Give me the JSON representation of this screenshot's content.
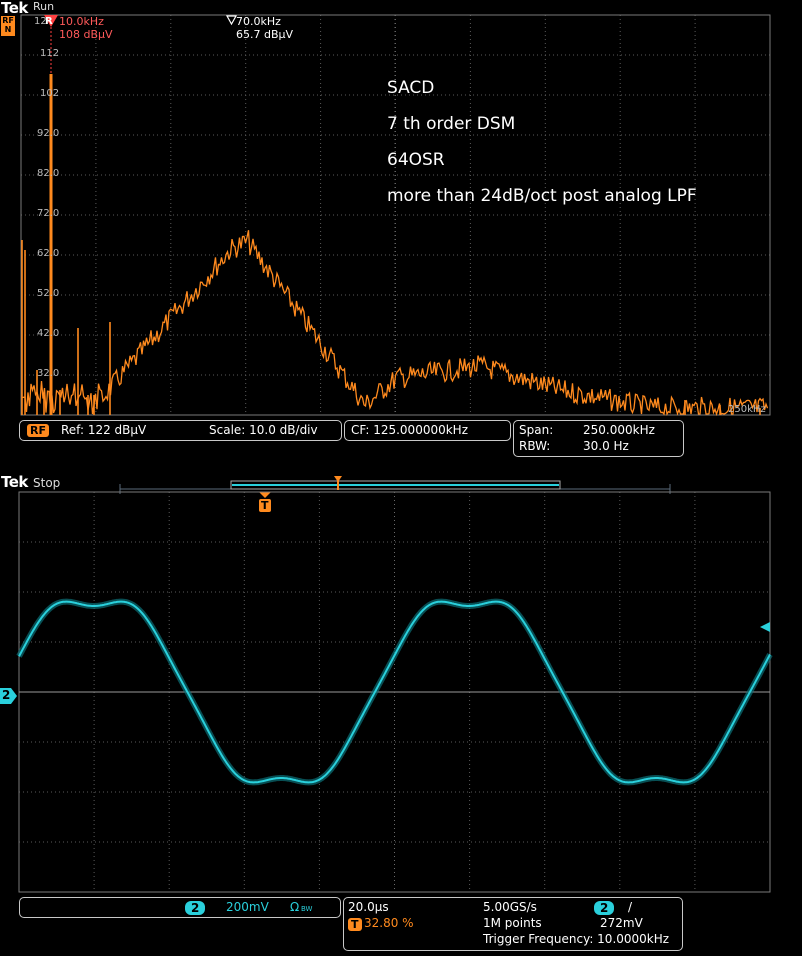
{
  "top": {
    "brand": "Tek",
    "run_state": "Run",
    "rf_icon_letters": "RF",
    "rf_icon_n": "N",
    "marker_ref": {
      "badge": "R",
      "freq": "10.0kHz",
      "level": "108 dBµV"
    },
    "marker_delta": {
      "freq": "70.0kHz",
      "level": "65.7 dBµV"
    },
    "y_labels": [
      "112",
      "102",
      "92.0",
      "82.0",
      "72.0",
      "62.0",
      "52.0",
      "42.0",
      "32.0"
    ],
    "y_top_partial": "12",
    "x_end_label": "250kHz",
    "annotation": [
      "SACD",
      "7 th order DSM",
      "64OSR",
      "more than 24dB/oct post analog LPF"
    ],
    "status": {
      "rf_badge": "RF",
      "ref": "Ref: 122 dBµV",
      "scale": "Scale: 10.0 dB/div",
      "cf": "CF:   125.000000kHz",
      "span_label": "Span:",
      "span_value": "250.000kHz",
      "rbw_label": "RBW:",
      "rbw_value": "30.0 Hz"
    },
    "colors": {
      "trace": "#ff8a1e",
      "grid": "#5a5a5a",
      "frame": "#7a7a7a"
    }
  },
  "bottom": {
    "brand": "Tek",
    "run_state": "Stop",
    "trigger_marker": "T",
    "channel_marker": "2",
    "status": {
      "ch_badge": "2",
      "volts_div": "200mV",
      "coupling": "Ω",
      "bw": "BW",
      "time_div": "20.0µs",
      "sample_rate": "5.00GS/s",
      "trig_ch_badge": "2",
      "trig_slope": "/",
      "trig_pos_badge": "T",
      "trig_pos": "32.80 %",
      "record_length": "1M points",
      "trig_level": "272mV",
      "trig_freq": "Trigger Frequency: 10.0000kHz"
    },
    "colors": {
      "trace": "#2ad0dc",
      "grid": "#5a5a5a",
      "frame": "#7a7a7a"
    }
  }
}
